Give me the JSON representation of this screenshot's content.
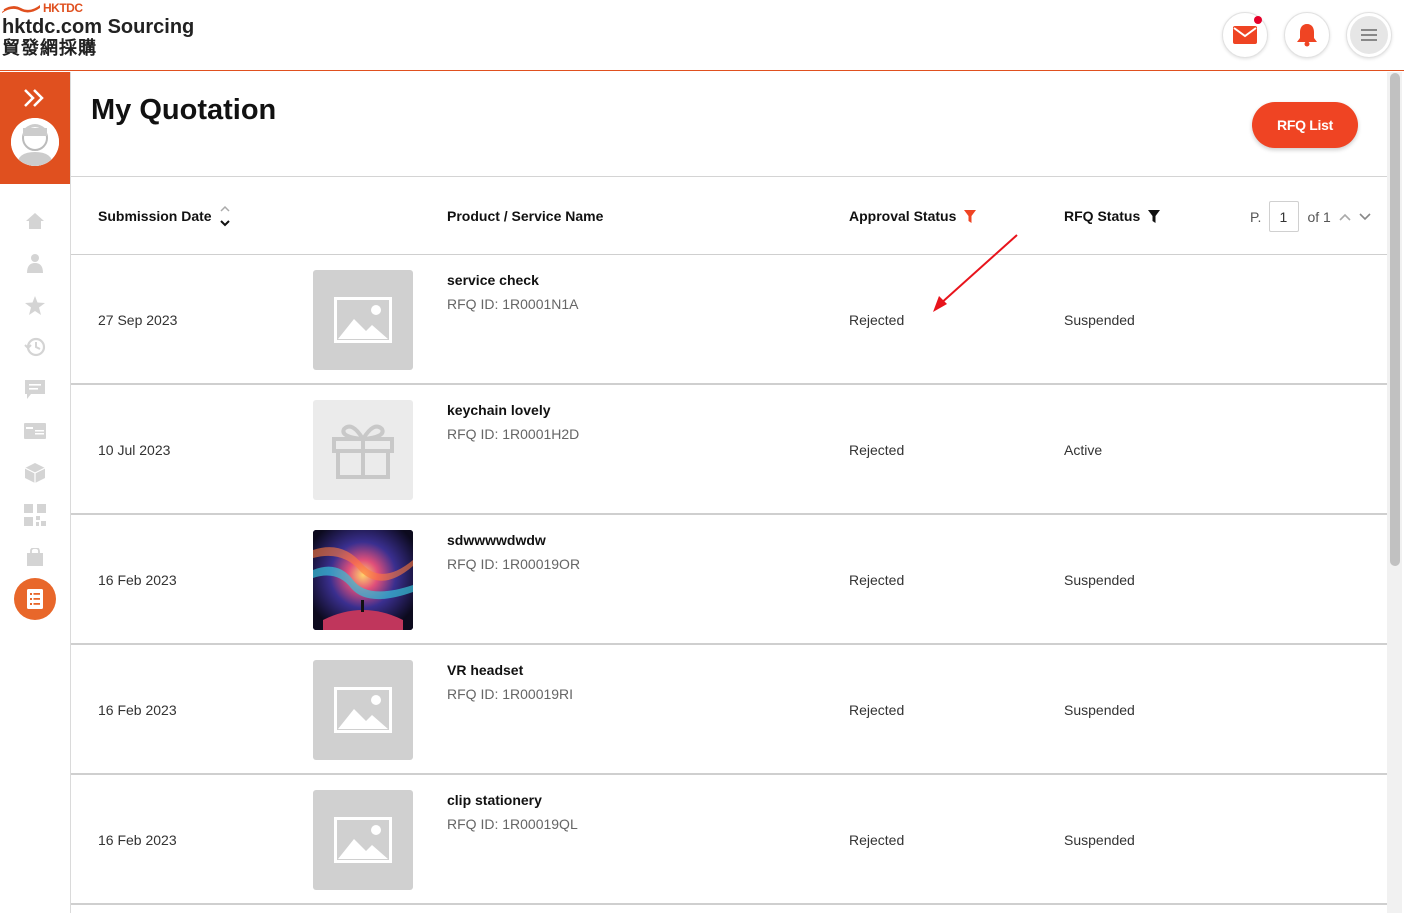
{
  "header": {
    "brand_small": "HKTDC",
    "brand_title": "hktdc.com Sourcing",
    "brand_chinese": "貿發網採購"
  },
  "page": {
    "title": "My Quotation",
    "rfq_list_button": "RFQ List"
  },
  "table": {
    "columns": {
      "submission_date": "Submission Date",
      "product_name": "Product / Service Name",
      "approval_status": "Approval Status",
      "rfq_status": "RFQ Status"
    },
    "pager": {
      "prefix": "P.",
      "current": "1",
      "of_label": "of 1"
    },
    "rows": [
      {
        "date": "27 Sep 2023",
        "name": "service check",
        "rfq_id": "RFQ ID: 1R0001N1A",
        "approval": "Rejected",
        "status": "Suspended",
        "thumb": "placeholder-image-icon"
      },
      {
        "date": "10 Jul 2023",
        "name": "keychain lovely",
        "rfq_id": "RFQ ID: 1R0001H2D",
        "approval": "Rejected",
        "status": "Active",
        "thumb": "gift-icon"
      },
      {
        "date": "16 Feb 2023",
        "name": "sdwwwwdwdw",
        "rfq_id": "RFQ ID: 1R00019OR",
        "approval": "Rejected",
        "status": "Suspended",
        "thumb": "product-photo"
      },
      {
        "date": "16 Feb 2023",
        "name": "VR headset",
        "rfq_id": "RFQ ID: 1R00019RI",
        "approval": "Rejected",
        "status": "Suspended",
        "thumb": "placeholder-image-icon"
      },
      {
        "date": "16 Feb 2023",
        "name": "clip stationery",
        "rfq_id": "RFQ ID: 1R00019QL",
        "approval": "Rejected",
        "status": "Suspended",
        "thumb": "placeholder-image-icon"
      }
    ]
  },
  "sidebar": {
    "icons": [
      "home-icon",
      "profile-icon",
      "star-icon",
      "history-icon",
      "message-icon",
      "card-icon",
      "package-icon",
      "qr-code-icon",
      "shopping-bag-icon",
      "quotation-icon"
    ]
  },
  "colors": {
    "brand_orange": "#e0501f",
    "button_red": "#ef4423",
    "notification_dot": "#e5002a",
    "filter_red": "#ef4423"
  }
}
